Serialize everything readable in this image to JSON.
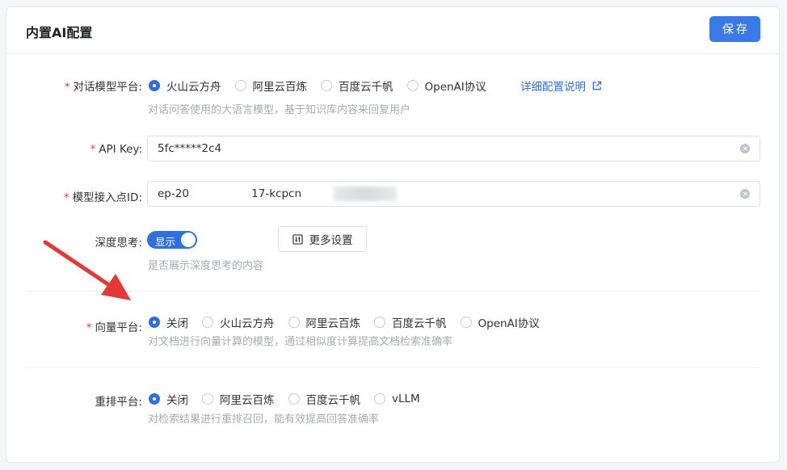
{
  "header": {
    "title": "内置AI配置",
    "save_label": "保存"
  },
  "chat_platform": {
    "required_mark": "*",
    "label": "对话模型平台:",
    "options": [
      "火山云方舟",
      "阿里云百炼",
      "百度云千帆",
      "OpenAI协议"
    ],
    "selected": 0,
    "help_link": "详细配置说明",
    "hint": "对话问答使用的大语言模型，基于知识库内容来回复用户"
  },
  "api_key": {
    "required_mark": "*",
    "label": "API Key:",
    "value": "5fc*****2c4"
  },
  "endpoint": {
    "required_mark": "*",
    "label": "模型接入点ID:",
    "value": "ep-20                  17-kcpcn"
  },
  "deep_think": {
    "label": "深度思考:",
    "switch_text": "显示",
    "enabled": true,
    "more_button": "更多设置",
    "hint": "是否展示深度思考的内容"
  },
  "vector_platform": {
    "required_mark": "*",
    "label": "向量平台:",
    "options": [
      "关闭",
      "火山云方舟",
      "阿里云百炼",
      "百度云千帆",
      "OpenAI协议"
    ],
    "selected": 0,
    "hint": "对文档进行向量计算的模型，通过相似度计算提高文档检索准确率"
  },
  "rerank_platform": {
    "label": "重排平台:",
    "options": [
      "关闭",
      "阿里云百炼",
      "百度云千帆",
      "vLLM"
    ],
    "selected": 0,
    "hint": "对检索结果进行重排召回，能有效提高回答准确率"
  },
  "colors": {
    "primary": "#2f6fe0",
    "required": "#e3463b",
    "arrow": "#e53935"
  },
  "icons": {
    "external_link": "external-link-icon",
    "settings": "sliders-icon",
    "clear": "clear-icon"
  }
}
